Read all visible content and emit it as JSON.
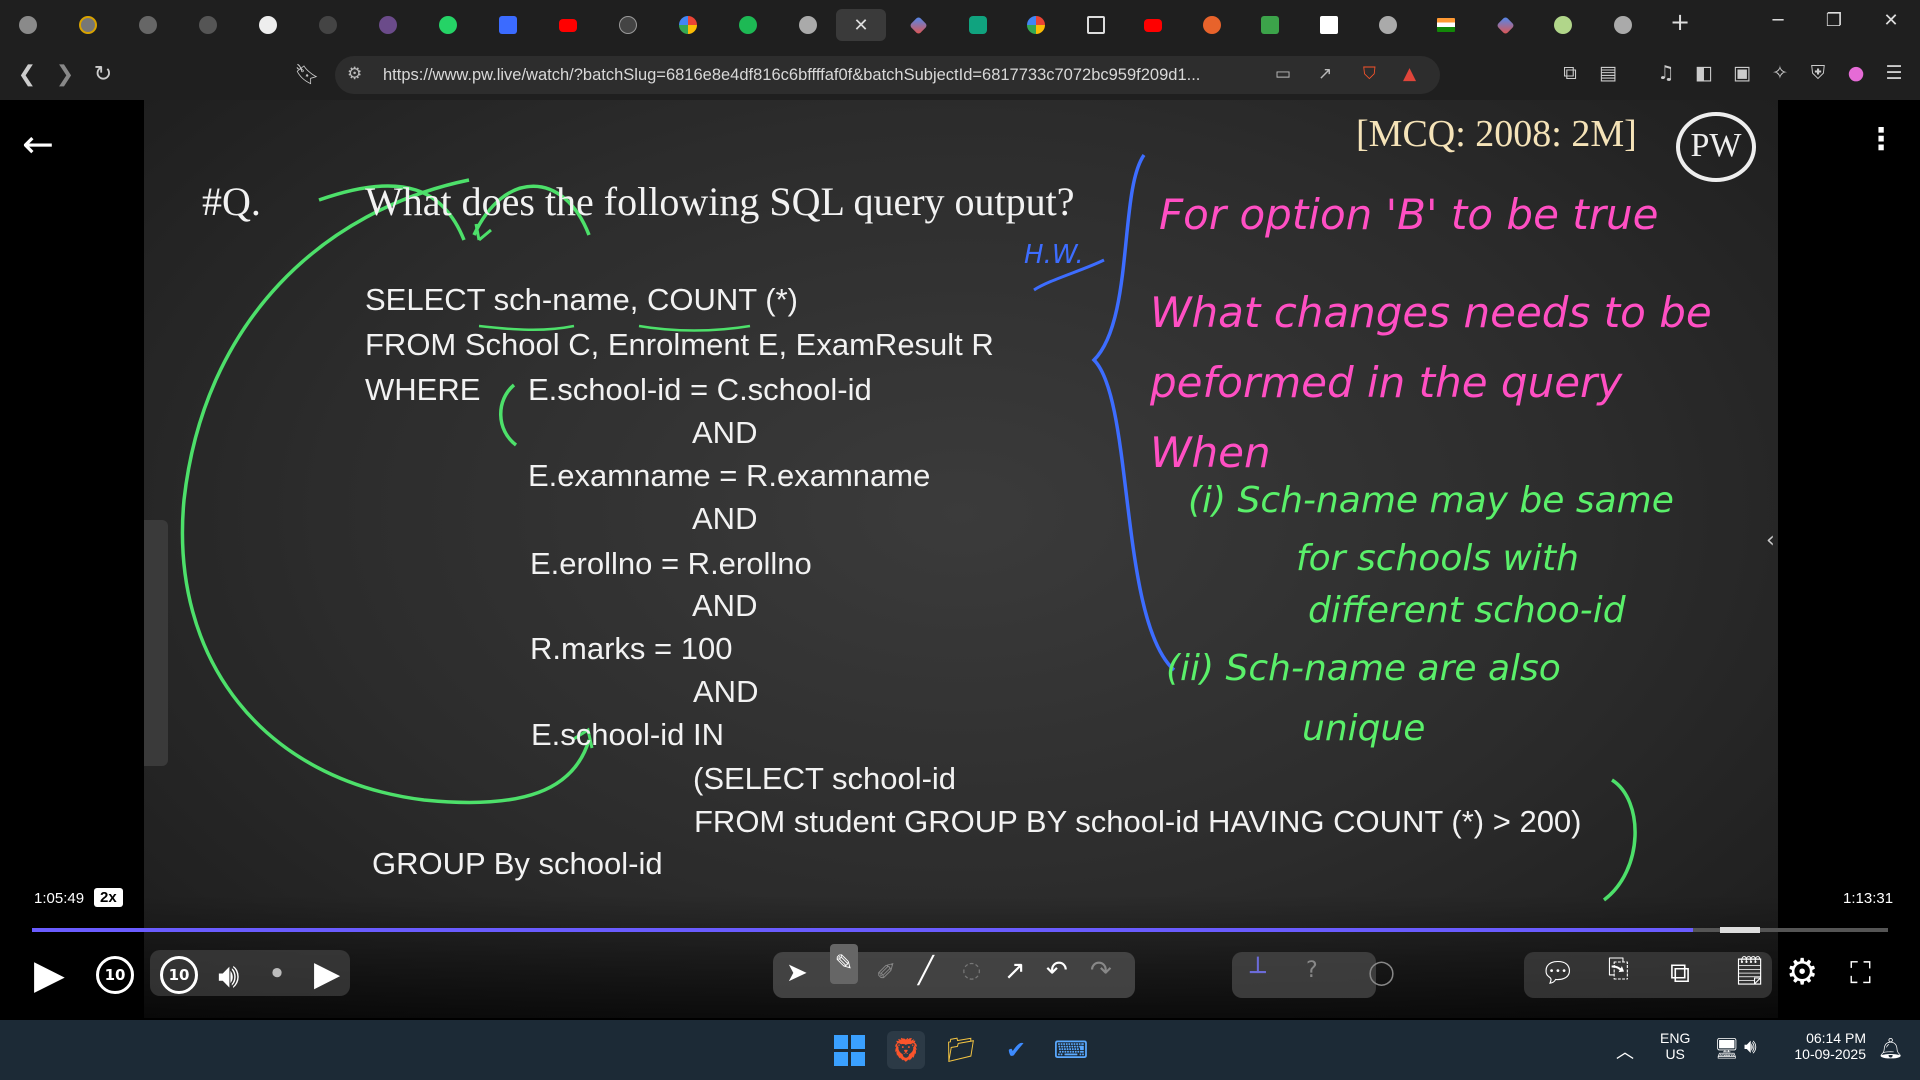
{
  "browser": {
    "active_tab_close": "✕",
    "new_tab": "+",
    "url": "https://www.pw.live/watch/?batchSlug=6816e8e4df816c6bffffaf0f&batchSubjectId=6817733c7072bc959f209d1...",
    "colors": {
      "accent": "#6a5cff",
      "tabbar": "#1f1f1f"
    }
  },
  "video": {
    "tag": "[MCQ: 2008: 2M]",
    "logo": "PW",
    "question_label": "#Q.",
    "question": "What does the following SQL query output?",
    "hw_label": "H.W.",
    "sql": [
      "SELECT sch-name, COUNT (*)",
      "FROM School C, Enrolment E, ExamResult R",
      "WHERE",
      "E.school-id = C.school-id",
      "AND",
      "E.examname = R.examname",
      "AND",
      "E.erollno = R.erollno",
      "AND",
      "R.marks = 100",
      "AND",
      "E.school-id IN",
      "(SELECT school-id",
      "FROM student GROUP BY school-id HAVING COUNT (*) > 200)",
      "GROUP By school-id"
    ],
    "notes": [
      "For option 'B' to be true",
      "What changes needs to be",
      "peformed in the query",
      "When",
      "(i) Sch-name may be same",
      "for schools with",
      "different schoo-id",
      "(ii) Sch-name are also",
      "unique"
    ]
  },
  "player": {
    "current_time": "1:05:49",
    "speed": "2x",
    "duration": "1:13:31",
    "progress_fraction": 0.895,
    "rewind_label": "10",
    "forward_label": "10"
  },
  "taskbar": {
    "lang": "ENG",
    "region": "US",
    "time": "06:14 PM",
    "date": "10-09-2025"
  }
}
